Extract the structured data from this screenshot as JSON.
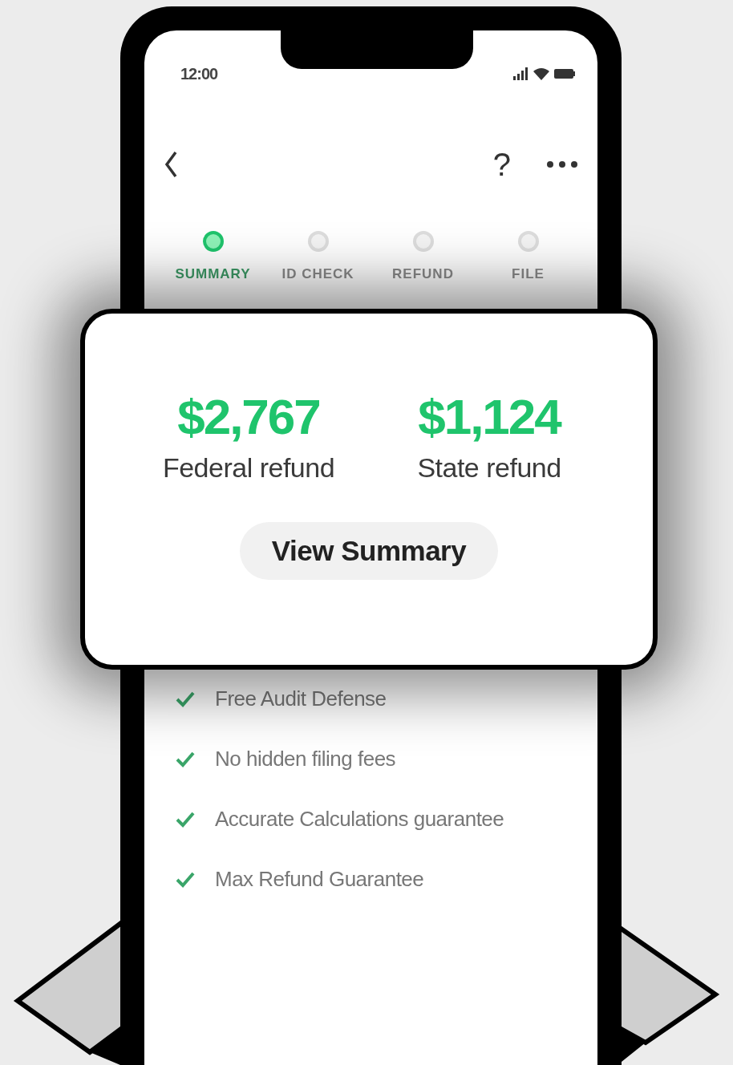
{
  "status_bar": {
    "time": "12:00"
  },
  "nav": {
    "help": "?"
  },
  "steps": [
    {
      "label": "SUMMARY",
      "selected": true
    },
    {
      "label": "ID CHECK",
      "selected": false
    },
    {
      "label": "REFUND",
      "selected": false
    },
    {
      "label": "FILE",
      "selected": false
    }
  ],
  "refunds": [
    {
      "amount": "$2,767",
      "label": "Federal refund"
    },
    {
      "amount": "$1,124",
      "label": "State refund"
    }
  ],
  "button": "View Summary",
  "features": [
    {
      "label": "Free Audit Defense",
      "checked": true
    },
    {
      "label": "No hidden filing fees",
      "checked": true
    },
    {
      "label": "Accurate Calculations guarantee",
      "checked": true
    },
    {
      "label": "Max Refund Guarantee",
      "checked": true
    }
  ]
}
